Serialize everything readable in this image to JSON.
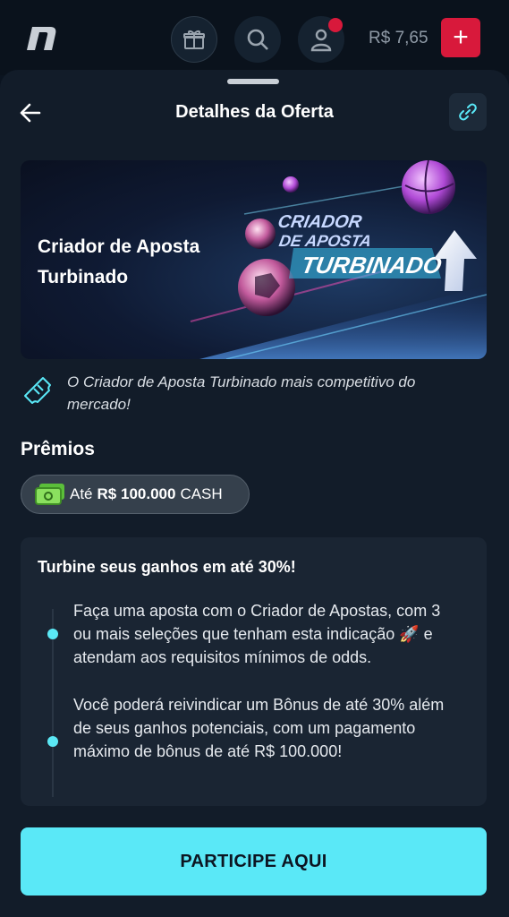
{
  "topbar": {
    "balance": "R$ 7,65",
    "deposit_label": "+"
  },
  "sheet": {
    "title": "Detalhes da Oferta"
  },
  "banner": {
    "title": "Criador de Aposta Turbinado",
    "art_line1": "CRIADOR",
    "art_line2": "DE APOSTA",
    "art_line3": "TURBINADO"
  },
  "description": "O Criador de Aposta Turbinado mais competitivo do mercado!",
  "prizes": {
    "title": "Prêmios",
    "prefix": "Até",
    "amount": "R$ 100.000",
    "suffix": "CASH"
  },
  "card": {
    "title": "Turbine seus ganhos em até 30%!",
    "steps": [
      "Faça uma aposta com o Criador de Apostas, com 3 ou mais seleções que tenham esta indicação 🚀 e atendam aos requisitos mínimos de odds.",
      "Você poderá reivindicar um Bônus de até 30% além de seus ganhos potenciais, com um pagamento máximo de bônus de até R$ 100.000!"
    ]
  },
  "cta": {
    "label": "PARTICIPE AQUI"
  },
  "colors": {
    "background": "#0b1420",
    "sheet": "#121c29",
    "accent_cyan": "#5ae8f7",
    "brand_red": "#d8193b"
  }
}
